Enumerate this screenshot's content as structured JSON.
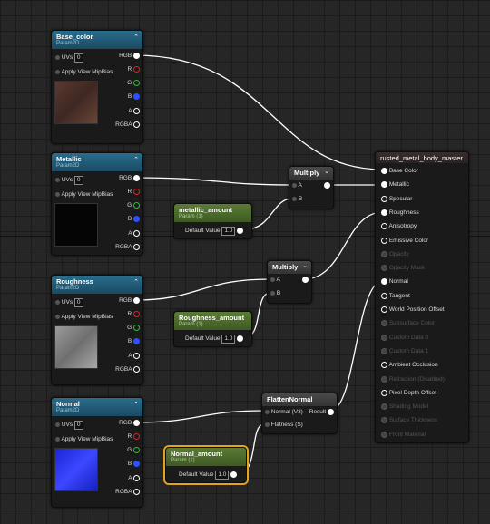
{
  "nodes": {
    "base_color": {
      "title": "Base_color",
      "subtitle": "Param2D",
      "uvs_label": "UVs",
      "uvs_value": "0",
      "mip": "Apply View MipBias"
    },
    "metallic": {
      "title": "Metallic",
      "subtitle": "Param2D",
      "uvs_label": "UVs",
      "uvs_value": "0",
      "mip": "Apply View MipBias"
    },
    "roughness": {
      "title": "Roughness",
      "subtitle": "Param2D",
      "uvs_label": "UVs",
      "uvs_value": "0",
      "mip": "Apply View MipBias"
    },
    "normal": {
      "title": "Normal",
      "subtitle": "Param2D",
      "uvs_label": "UVs",
      "uvs_value": "0",
      "mip": "Apply View MipBias"
    },
    "outputs": {
      "rgb": "RGB",
      "r": "R",
      "g": "G",
      "b": "B",
      "a": "A",
      "rgba": "RGBA"
    },
    "metallic_amount": {
      "title": "metallic_amount",
      "subtitle": "Param (1)",
      "label": "Default Value",
      "value": "1.0"
    },
    "roughness_amount": {
      "title": "Roughness_amount",
      "subtitle": "Param (1)",
      "label": "Default Value",
      "value": "1.0"
    },
    "normal_amount": {
      "title": "Normal_amount",
      "subtitle": "Param (1)",
      "label": "Default Value",
      "value": "1.0"
    },
    "multiply1": {
      "title": "Multiply",
      "a": "A",
      "b": "B"
    },
    "multiply2": {
      "title": "Multiply",
      "a": "A",
      "b": "B"
    },
    "flatten": {
      "title": "FlattenNormal",
      "in1": "Normal (V3)",
      "out": "Result",
      "in2": "Flatness (S)"
    },
    "material": {
      "title": "rusted_metal_body_master",
      "pins": [
        {
          "label": "Base Color",
          "active": true
        },
        {
          "label": "Metallic",
          "active": true
        },
        {
          "label": "Specular",
          "active": true
        },
        {
          "label": "Roughness",
          "active": true
        },
        {
          "label": "Anisotropy",
          "active": true
        },
        {
          "label": "Emissive Color",
          "active": true
        },
        {
          "label": "Opacity",
          "active": false
        },
        {
          "label": "Opacity Mask",
          "active": false
        },
        {
          "label": "Normal",
          "active": true
        },
        {
          "label": "Tangent",
          "active": true
        },
        {
          "label": "World Position Offset",
          "active": true
        },
        {
          "label": "Subsurface Color",
          "active": false
        },
        {
          "label": "Custom Data 0",
          "active": false
        },
        {
          "label": "Custom Data 1",
          "active": false
        },
        {
          "label": "Ambient Occlusion",
          "active": true
        },
        {
          "label": "Refraction (Disabled)",
          "active": false
        },
        {
          "label": "Pixel Depth Offset",
          "active": true
        },
        {
          "label": "Shading Model",
          "active": false
        },
        {
          "label": "Surface Thickness",
          "active": false
        },
        {
          "label": "Front Material",
          "active": false
        }
      ]
    }
  },
  "colors": {
    "blue_header": "#2a6d8c",
    "green_header": "#5b7b37",
    "selection": "#e3a31c",
    "wire": "#ffffff"
  }
}
